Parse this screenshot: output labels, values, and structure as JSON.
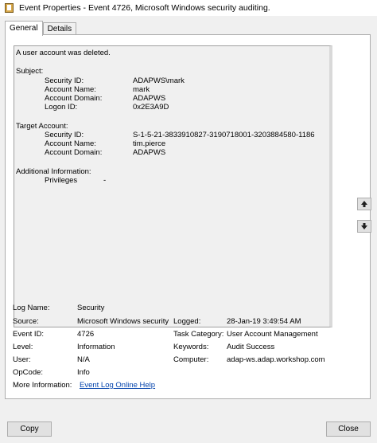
{
  "window": {
    "title": "Event Properties - Event 4726, Microsoft Windows security auditing."
  },
  "tabs": [
    {
      "label": "General"
    },
    {
      "label": "Details"
    }
  ],
  "description": {
    "headline": "A user account was deleted.",
    "subject_heading": "Subject:",
    "subject": [
      {
        "label": "Security ID:",
        "value": "ADAPWS\\mark"
      },
      {
        "label": "Account Name:",
        "value": "mark"
      },
      {
        "label": "Account Domain:",
        "value": "ADAPWS"
      },
      {
        "label": "Logon ID:",
        "value": "0x2E3A9D"
      }
    ],
    "target_heading": "Target Account:",
    "target": [
      {
        "label": "Security ID:",
        "value": "S-1-5-21-3833910827-3190718001-3203884580-1186"
      },
      {
        "label": "Account Name:",
        "value": "tim.pierce"
      },
      {
        "label": "Account Domain:",
        "value": "ADAPWS"
      }
    ],
    "additional_heading": "Additional Information:",
    "additional": [
      {
        "label": "Privileges",
        "value": "-"
      }
    ]
  },
  "meta": {
    "log_name_label": "Log Name:",
    "log_name": "Security",
    "source_label": "Source:",
    "source": "Microsoft Windows security",
    "logged_label": "Logged:",
    "logged": "28-Jan-19 3:49:54 AM",
    "event_id_label": "Event ID:",
    "event_id": "4726",
    "task_category_label": "Task Category:",
    "task_category": "User Account Management",
    "level_label": "Level:",
    "level": "Information",
    "keywords_label": "Keywords:",
    "keywords": "Audit Success",
    "user_label": "User:",
    "user": "N/A",
    "computer_label": "Computer:",
    "computer": "adap-ws.adap.workshop.com",
    "opcode_label": "OpCode:",
    "opcode": "Info",
    "more_info_label": "More Information:",
    "more_info_link": "Event Log Online Help"
  },
  "buttons": {
    "copy": "Copy",
    "close": "Close"
  },
  "icons": {
    "up": "arrow-up-icon",
    "down": "arrow-down-icon"
  }
}
